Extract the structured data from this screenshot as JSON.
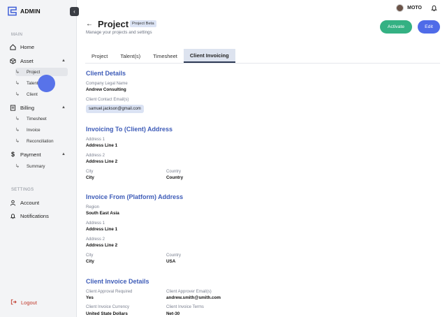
{
  "app": {
    "name": "ADMIN"
  },
  "user": {
    "name": "MOTO"
  },
  "sidebar": {
    "main_label": "MAIN",
    "settings_label": "SETTINGS",
    "home": "Home",
    "asset": "Asset",
    "asset_items": [
      "Project",
      "Talent",
      "Client"
    ],
    "billing": "Billing",
    "billing_items": [
      "Timesheet",
      "Invoice",
      "Reconciliation"
    ],
    "payment": "Payment",
    "payment_items": [
      "Summary"
    ],
    "account": "Account",
    "notifications": "Notifications",
    "logout": "Logout"
  },
  "header": {
    "title": "Project",
    "badge": "Project Beta",
    "subtitle": "Manage your projects and settings",
    "activate": "Activate",
    "edit": "Edit"
  },
  "tabs": [
    "Project",
    "Talent(s)",
    "Timesheet",
    "Client Invoicing"
  ],
  "client_details": {
    "title": "Client Details",
    "company_label": "Company Legal Name",
    "company_value": "Andrew Consulting",
    "email_label": "Client Contact Email(s)",
    "email_value": "samuel.jackson@gmail.com"
  },
  "invoicing_to": {
    "title": "Invoicing To (Client) Address",
    "address1_label": "Address 1",
    "address1_value": "Address Line 1",
    "address2_label": "Address 2",
    "address2_value": "Address Line 2",
    "city_label": "City",
    "city_value": "City",
    "country_label": "Country",
    "country_value": "Country"
  },
  "invoice_from": {
    "title": "Invoice From (Platform) Address",
    "region_label": "Region",
    "region_value": "South East Asia",
    "address1_label": "Address 1",
    "address1_value": "Address Line 1",
    "address2_label": "Address 2",
    "address2_value": "Address Line 2",
    "city_label": "City",
    "city_value": "City",
    "country_label": "Country",
    "country_value": "USA"
  },
  "invoice_details": {
    "title": "Client Invoice Details",
    "approval_label": "Client Approval Required",
    "approval_value": "Yes",
    "approver_label": "Client Approver Email(s)",
    "approver_value": "andrew.smith@smith.com",
    "currency_label": "Client Invoice Currency",
    "currency_value": "United State Dollars",
    "terms_label": "Client Invoice Terms",
    "terms_value": "Net-30"
  }
}
